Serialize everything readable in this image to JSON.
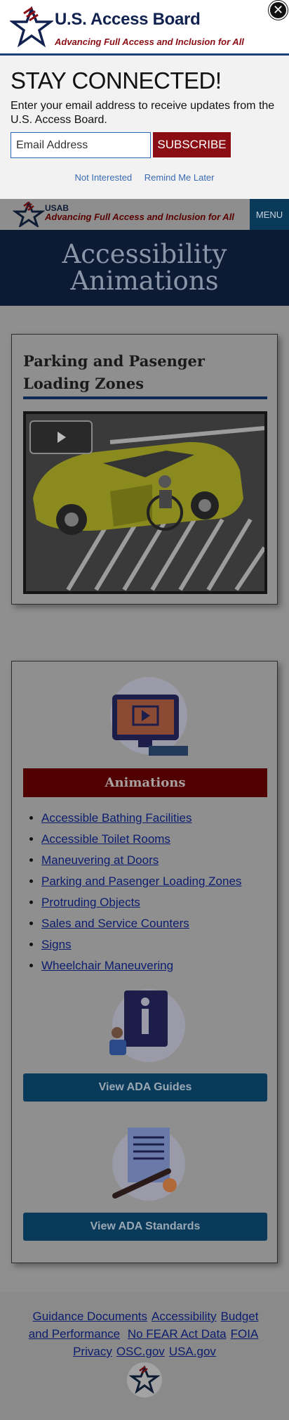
{
  "modal": {
    "site_name": "U.S. Access Board",
    "tagline": "Advancing Full Access and Inclusion for All",
    "heading": "STAY CONNECTED!",
    "description": "Enter your email address to receive updates from the U.S. Access Board.",
    "email_placeholder": "Email Address",
    "subscribe_label": "SUBSCRIBE",
    "not_interested": "Not Interested",
    "remind_later": "Remind Me Later",
    "close_icon": "close-icon"
  },
  "header": {
    "short_name": "USAB",
    "tagline": "Advancing Full Access and Inclusion for All",
    "menu_label": "MENU"
  },
  "hero": {
    "title": "Accessibility Animations"
  },
  "video_card": {
    "title": "Parking and Pasenger Loading Zones",
    "play_icon": "play-icon"
  },
  "animations_card": {
    "section_label": "Animations",
    "links": [
      "Accessible Bathing Facilities",
      "Accessible Toilet Rooms",
      "Maneuvering at Doors",
      "Parking and Pasenger Loading Zones",
      "Protruding Objects",
      "Sales and Service Counters",
      "Signs",
      "Wheelchair Maneuvering"
    ],
    "guides_button": "View ADA Guides",
    "standards_button": "View ADA Standards"
  },
  "footer": {
    "links": [
      "Guidance Documents",
      "Accessibility",
      "Budget and Performance",
      "No FEAR Act Data",
      "FOIA",
      "Privacy",
      "OSC.gov",
      "USA.gov"
    ]
  },
  "colors": {
    "navy": "#112250",
    "brand_red": "#8a0d14",
    "button_blue": "#0a3a5a",
    "overlay_gray": "#8f8f8f"
  }
}
